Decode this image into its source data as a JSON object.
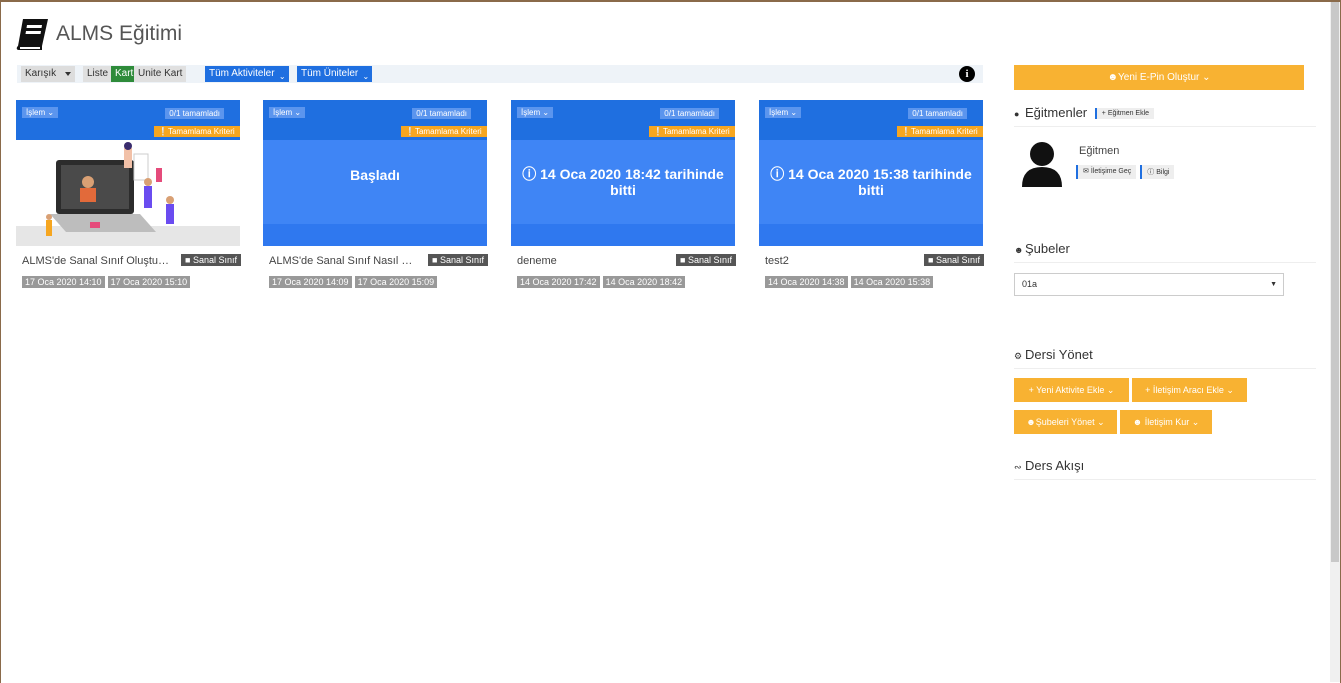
{
  "app": {
    "title": "ALMS Eğitimi"
  },
  "toolbar": {
    "sort_select": "Karışık",
    "view_list": "Liste",
    "view_card": "Kart",
    "view_unit_card": "Unite Kart",
    "activities_dropdown": "Tüm Aktiviteler",
    "units_dropdown": "Tüm Üniteler",
    "info_icon": "info-circle-icon"
  },
  "cards": [
    {
      "islem": "İşlem",
      "progress": "0/1 tamamladı",
      "criteria": "Tamamlama Kriteri",
      "status": "",
      "title": "ALMS'de Sanal Sınıf Oluşturma",
      "type": "Sanal Sınıf",
      "start": "17 Oca 2020 14:10",
      "end": "17 Oca 2020 15:10"
    },
    {
      "islem": "İşlem",
      "progress": "0/1 tamamladı",
      "criteria": "Tamamlama Kriteri",
      "status": "Başladı",
      "title": "ALMS'de Sanal Sınıf Nasıl Oluş...",
      "type": "Sanal Sınıf",
      "start": "17 Oca 2020 14:09",
      "end": "17 Oca 2020 15:09"
    },
    {
      "islem": "İşlem",
      "progress": "0/1 tamamladı",
      "criteria": "Tamamlama Kriteri",
      "status": "14 Oca 2020 18:42 tarihinde bitti",
      "title": "deneme",
      "type": "Sanal Sınıf",
      "start": "14 Oca 2020 17:42",
      "end": "14 Oca 2020 18:42"
    },
    {
      "islem": "İşlem",
      "progress": "0/1 tamamladı",
      "criteria": "Tamamlama Kriteri",
      "status": "14 Oca 2020 15:38 tarihinde bitti",
      "title": "test2",
      "type": "Sanal Sınıf",
      "start": "14 Oca 2020 14:38",
      "end": "14 Oca 2020 15:38"
    }
  ],
  "sidebar": {
    "epin_button": "Yeni E-Pin Oluştur",
    "instructors_heading": "Eğitmenler",
    "add_instructor": "Eğitmen Ekle",
    "instructor_name": "Eğitmen",
    "contact_button": "İletişime Geç",
    "info_button": "Bilgi",
    "branches_heading": "Şubeler",
    "branch_selected": "01a",
    "manage_heading": "Dersi Yönet",
    "new_activity": "Yeni Aktivite Ekle",
    "comm_tool": "İletişim Aracı Ekle",
    "manage_branches": "Şubeleri Yönet",
    "contact": "İletişim Kur",
    "stream_heading": "Ders Akışı"
  },
  "colors": {
    "accent_blue": "#1f6fe0",
    "card_blue": "#3f85f5",
    "orange": "#f8b232",
    "green": "#2e8b3a"
  }
}
